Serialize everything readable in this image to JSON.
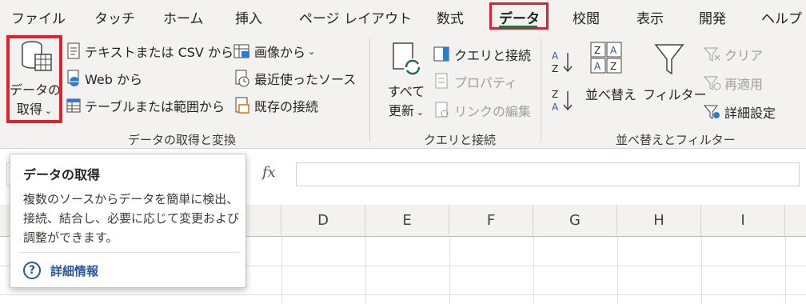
{
  "tabs": [
    "ファイル",
    "タッチ",
    "ホーム",
    "挿入",
    "ページ レイアウト",
    "数式",
    "データ",
    "校閲",
    "表示",
    "開発",
    "ヘルプ"
  ],
  "ribbon": {
    "get_data": {
      "line1": "データの",
      "line2": "取得"
    },
    "text_csv": "テキストまたは CSV から",
    "web": "Web から",
    "table_range": "テーブルまたは範囲から",
    "from_image": "画像から",
    "recent_sources": "最近使ったソース",
    "existing_connections": "既存の接続",
    "group1_label": "データの取得と変換",
    "refresh_all": {
      "line1": "すべて",
      "line2": "更新"
    },
    "queries_connections": "クエリと接続",
    "properties": "プロパティ",
    "edit_links": "リンクの編集",
    "group2_label": "クエリと接続",
    "sort": "並べ替え",
    "filter": "フィルター",
    "clear": "クリア",
    "reapply": "再適用",
    "advanced": "詳細設定",
    "group3_label": "並べ替えとフィルター"
  },
  "formula_bar": {
    "fx": "fx"
  },
  "columns": [
    "D",
    "E",
    "F",
    "G",
    "H",
    "I"
  ],
  "tooltip": {
    "title": "データの取得",
    "body": "複数のソースからデータを簡単に検出、接続、結合し、必要に応じて変更および調整ができます。",
    "link": "詳細情報"
  },
  "colors": {
    "accent_red": "#e0202a",
    "excel_green": "#217346",
    "link_blue": "#2b579a"
  }
}
